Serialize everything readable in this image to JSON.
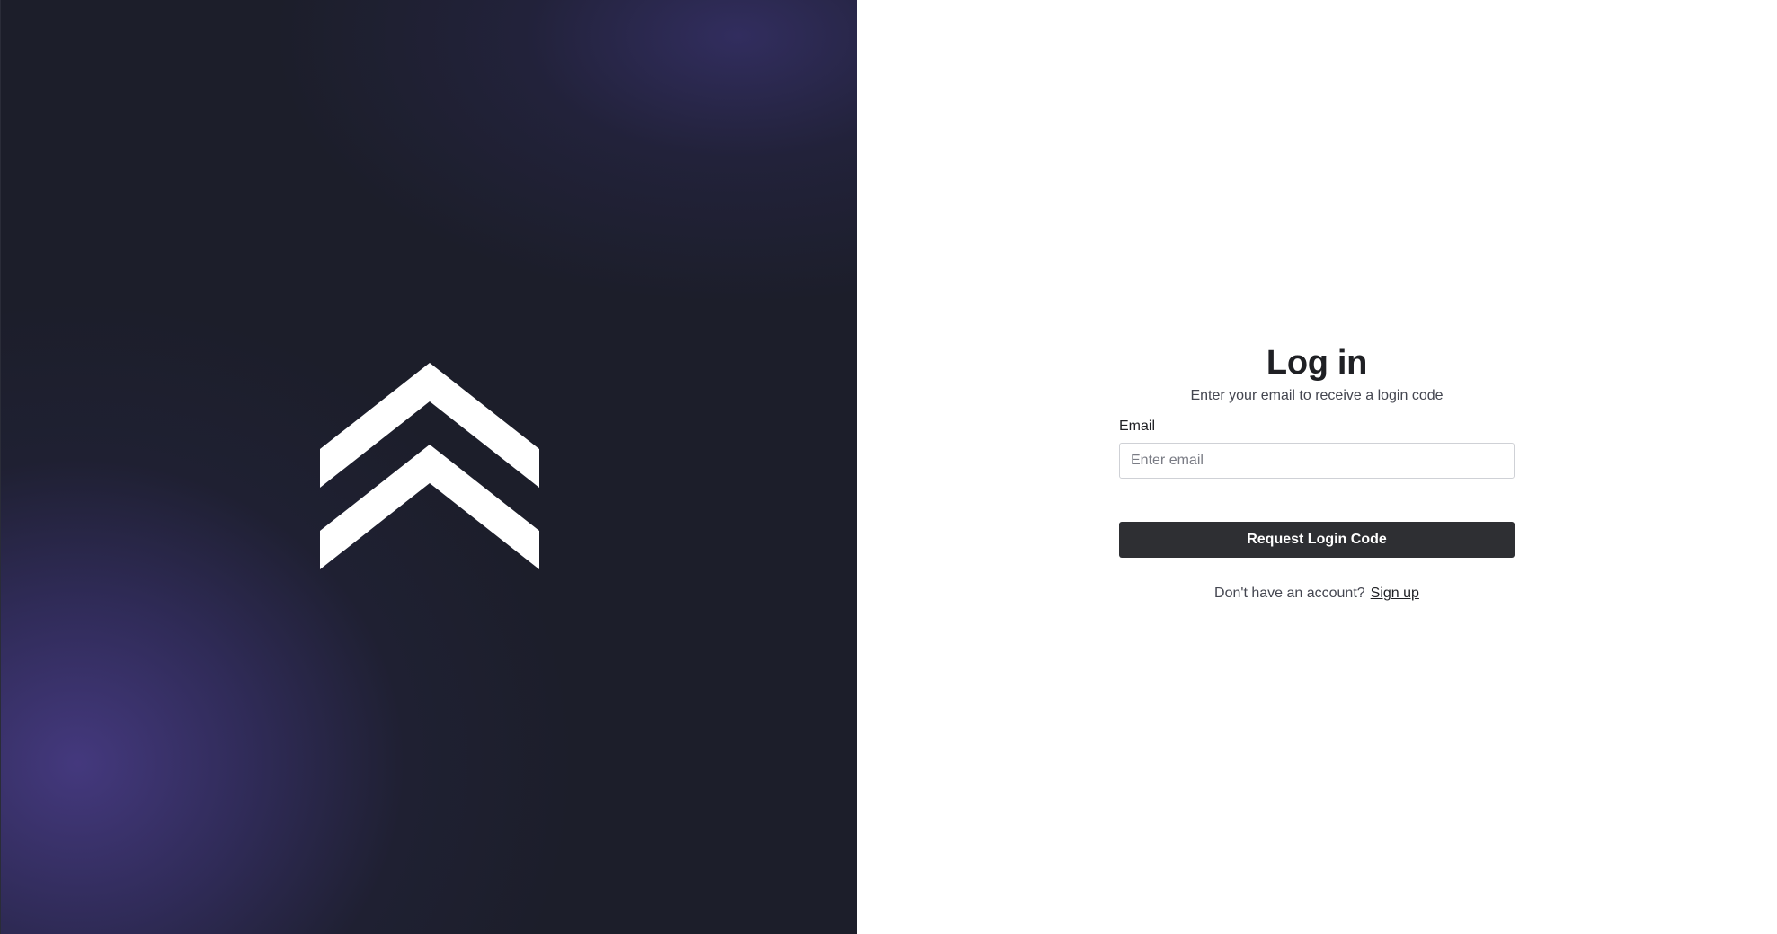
{
  "brand": {
    "logo_icon": "double-chevron-up-icon",
    "logo_color": "#ffffff",
    "background_color": "#1c1e2a",
    "glow_color": "#463a82"
  },
  "login": {
    "title": "Log in",
    "subtitle": "Enter your email to receive a login code",
    "email_label": "Email",
    "email_value": "",
    "email_placeholder": "Enter email",
    "submit_label": "Request Login Code",
    "signup_prompt": "Don't have an account?",
    "signup_link": "Sign up"
  },
  "colors": {
    "button_background": "#2e2f33",
    "button_text": "#ffffff",
    "heading_text": "#1f2024"
  }
}
